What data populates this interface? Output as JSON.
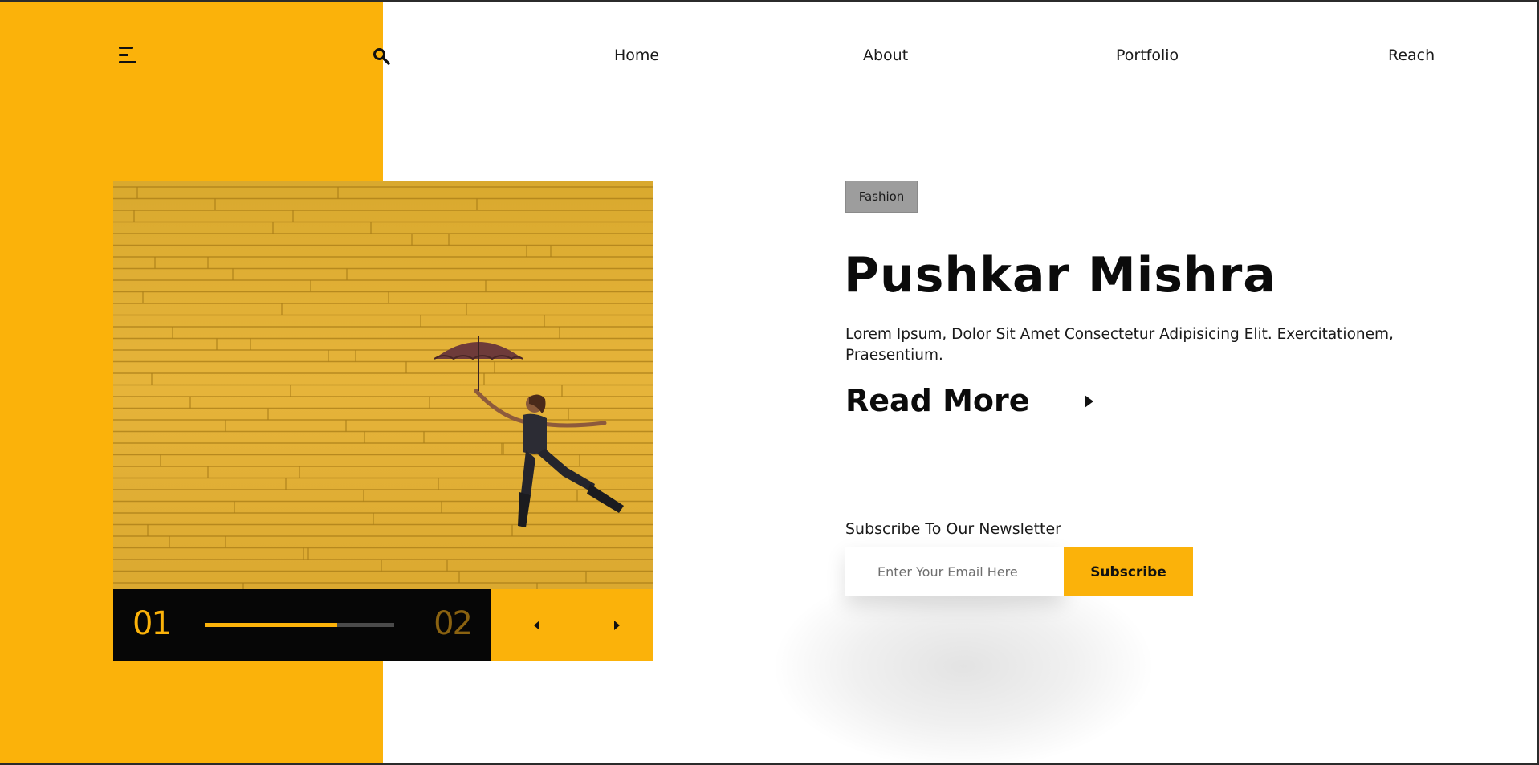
{
  "nav": {
    "items": [
      {
        "label": "Home"
      },
      {
        "label": "About"
      },
      {
        "label": "Portfolio"
      },
      {
        "label": "Reach"
      }
    ]
  },
  "icons": {
    "menu": "hamburger-menu-icon",
    "search": "search-icon",
    "prev": "caret-left-icon",
    "next": "caret-right-icon",
    "read_more": "caret-right-icon"
  },
  "slider": {
    "current": "01",
    "next": "02",
    "progress": 0.7
  },
  "hero": {
    "tag": "Fashion",
    "title": "Pushkar Mishra",
    "description": "Lorem Ipsum, Dolor Sit Amet Consectetur Adipisicing Elit. Exercitationem, Praesentium.",
    "read_more": "Read More"
  },
  "newsletter": {
    "label": "Subscribe To Our Newsletter",
    "placeholder": "Enter Your Email Here",
    "button": "Subscribe"
  },
  "colors": {
    "accent": "#fbb20a",
    "dark": "#060606",
    "tag_bg": "#9d9d9d"
  }
}
